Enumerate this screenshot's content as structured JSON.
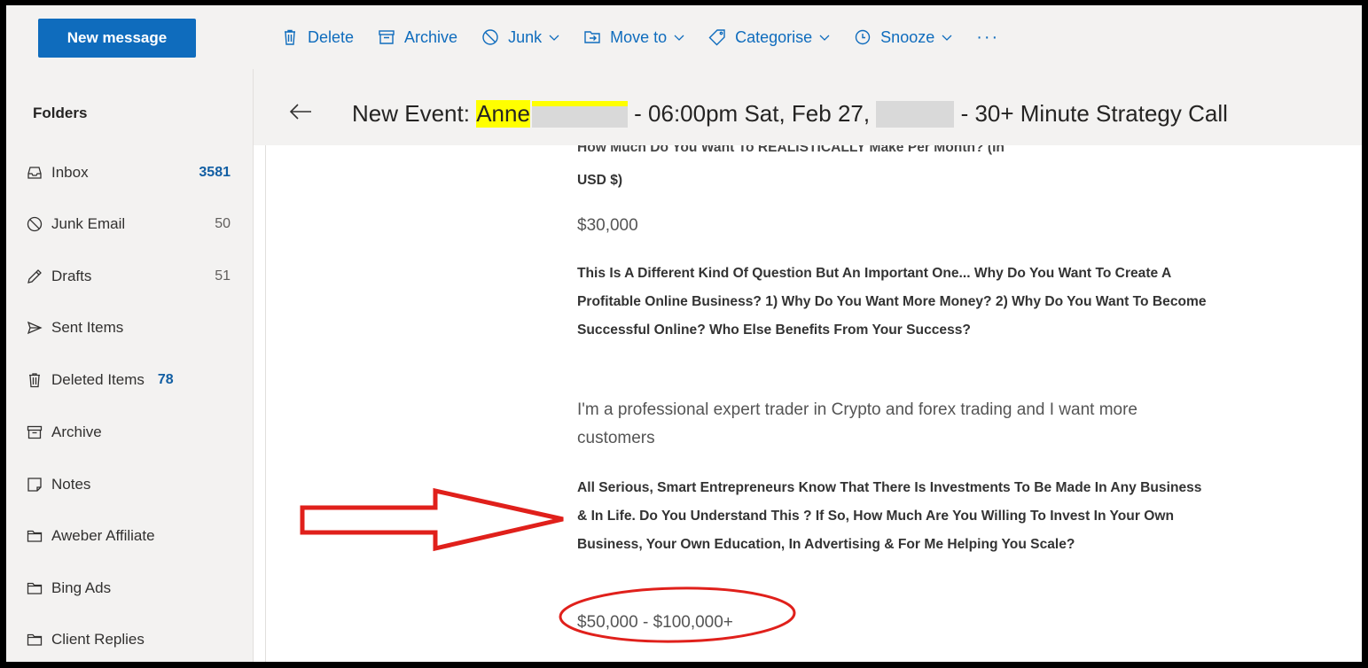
{
  "toolbar": {
    "new_message": "New message",
    "actions": {
      "delete": "Delete",
      "archive": "Archive",
      "junk": "Junk",
      "move_to": "Move to",
      "categorise": "Categorise",
      "snooze": "Snooze",
      "more": "···"
    },
    "accent_color": "#0f6cbd"
  },
  "sidebar": {
    "header": "Folders",
    "items": [
      {
        "label": "Inbox",
        "count": "3581",
        "icon": "inbox-icon"
      },
      {
        "label": "Junk Email",
        "count": "50",
        "icon": "block-icon"
      },
      {
        "label": "Drafts",
        "count": "51",
        "icon": "pencil-icon"
      },
      {
        "label": "Sent Items",
        "count": "",
        "icon": "send-icon"
      },
      {
        "label": "Deleted Items",
        "count": "78",
        "icon": "trash-icon"
      },
      {
        "label": "Archive",
        "count": "",
        "icon": "archive-icon"
      },
      {
        "label": "Notes",
        "count": "",
        "icon": "note-icon"
      },
      {
        "label": "Aweber Affiliate",
        "count": "",
        "icon": "folder-icon"
      },
      {
        "label": "Bing Ads",
        "count": "",
        "icon": "folder-icon"
      },
      {
        "label": "Client Replies",
        "count": "",
        "icon": "folder-icon"
      }
    ]
  },
  "message": {
    "subject_prefix": "New Event:",
    "subject_name": "Anne",
    "subject_mid": "- 06:00pm Sat, Feb 27,",
    "subject_end": "- 30+ Minute Strategy Call",
    "cut_line": "How Much Do You Want To REALISTICALLY Make Per Month? (In",
    "q1_tail": "USD $)",
    "a1": "$30,000",
    "q2": "This Is A Different Kind Of Question But An Important One... Why Do You Want To Create A Profitable Online Business? 1) Why Do You Want More Money? 2) Why Do You Want To Become Successful Online? Who Else Benefits From Your Success?",
    "a2": "I'm a professional expert trader in Crypto and forex trading and I want more customers",
    "q3": "All Serious, Smart Entrepreneurs Know That There Is Investments To Be Made In Any Business & In Life. Do You Understand This ? If So, How Much Are You Willing To Invest In Your Own Business, Your Own Education, In Advertising & For Me Helping You Scale?",
    "a3": "$50,000 - $100,000+"
  },
  "annotation_color": "#e0201b"
}
